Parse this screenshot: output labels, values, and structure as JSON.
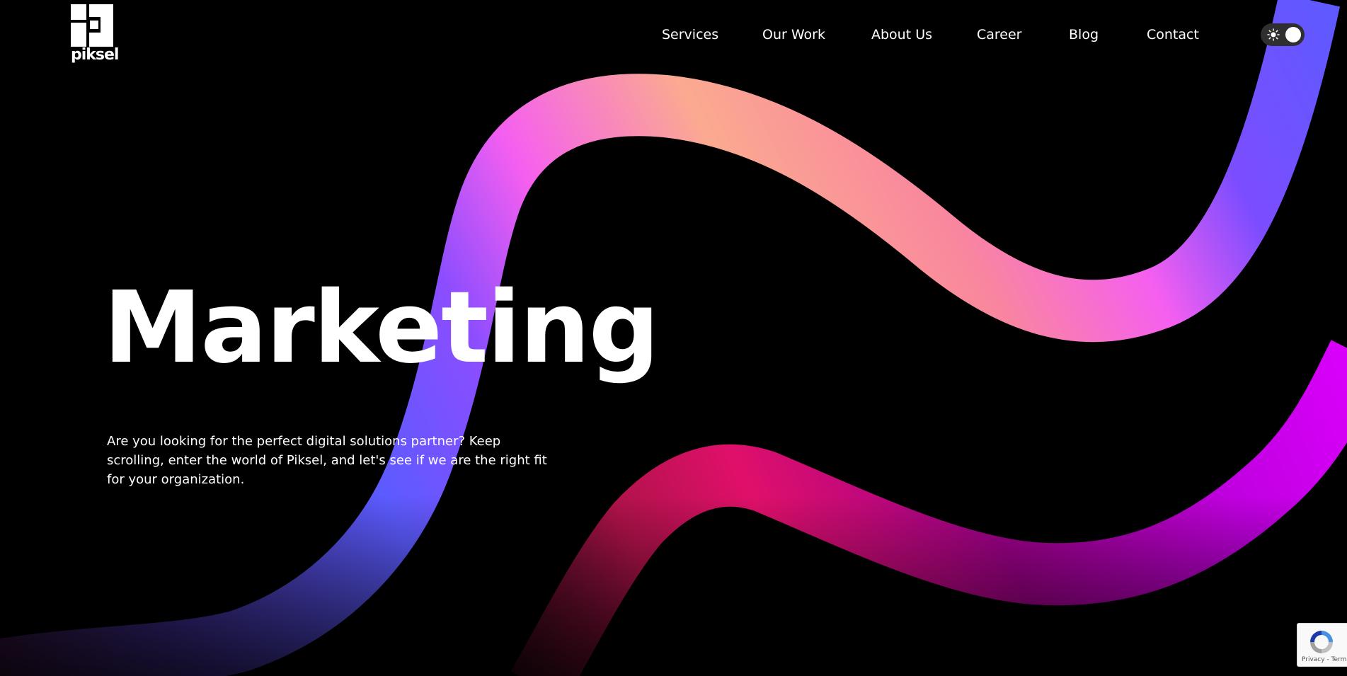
{
  "brand": {
    "name": "piksel"
  },
  "nav": {
    "items": [
      {
        "label": "Services"
      },
      {
        "label": "Our Work"
      },
      {
        "label": "About Us"
      },
      {
        "label": "Career"
      },
      {
        "label": "Blog"
      },
      {
        "label": "Contact"
      }
    ]
  },
  "theme_toggle": {
    "icon": "sun-icon",
    "state": "light"
  },
  "hero": {
    "title": "Marketing",
    "description": "Are you looking for the perfect digital solutions partner? Keep scrolling, enter the world of Piksel, and let's see if we are the right fit for your organization."
  },
  "recaptcha": {
    "links": "Privacy - Terms"
  },
  "colors": {
    "background": "#000000",
    "ribbon_violet": "#8b4dff",
    "ribbon_blue": "#5b5bff",
    "ribbon_pink": "#f55ff0",
    "ribbon_peach": "#fbaa90",
    "ribbon_magenta": "#dd00ff",
    "ribbon_crimson": "#e0106a"
  }
}
